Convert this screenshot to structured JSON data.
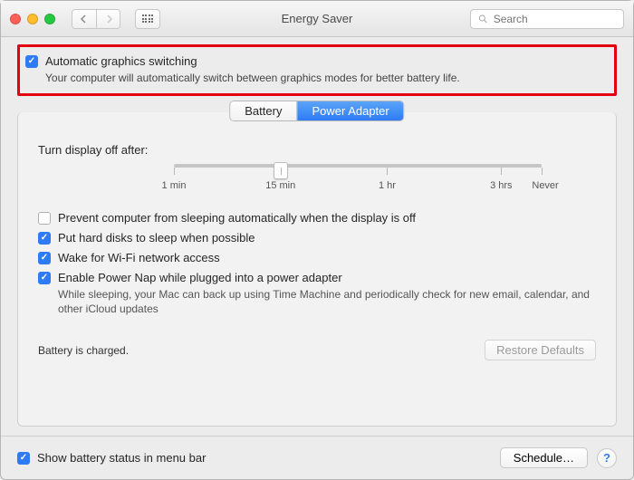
{
  "window": {
    "title": "Energy Saver"
  },
  "search": {
    "placeholder": "Search"
  },
  "highlighted": {
    "label": "Automatic graphics switching",
    "desc": "Your computer will automatically switch between graphics modes for better battery life."
  },
  "tabs": {
    "battery": "Battery",
    "power_adapter": "Power Adapter"
  },
  "slider": {
    "label": "Turn display off after:",
    "ticks": {
      "min": "1 min",
      "fifteen": "15 min",
      "hour": "1 hr",
      "three": "3 hrs",
      "never": "Never"
    }
  },
  "options": {
    "prevent_sleep": "Prevent computer from sleeping automatically when the display is off",
    "hard_disks": "Put hard disks to sleep when possible",
    "wake_wifi": "Wake for Wi-Fi network access",
    "power_nap": "Enable Power Nap while plugged into a power adapter",
    "power_nap_desc": "While sleeping, your Mac can back up using Time Machine and periodically check for new email, calendar, and other iCloud updates"
  },
  "status": "Battery is charged.",
  "buttons": {
    "restore": "Restore Defaults",
    "schedule": "Schedule…",
    "help": "?"
  },
  "menubar": {
    "show_battery": "Show battery status in menu bar"
  }
}
